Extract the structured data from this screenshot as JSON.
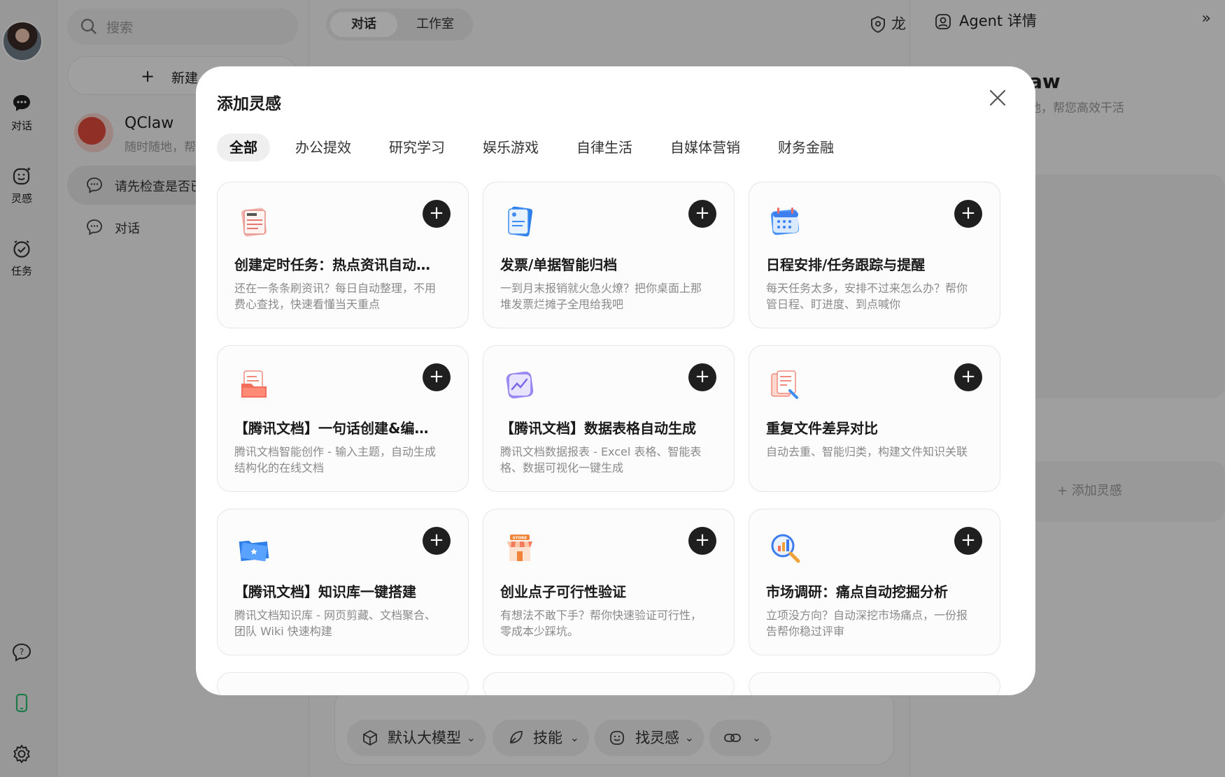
{
  "rail": {
    "items": [
      {
        "label": "对话",
        "icon": "chat-bubble-icon"
      },
      {
        "label": "灵感",
        "icon": "smile-sparkle-icon"
      },
      {
        "label": "任务",
        "icon": "clock-check-icon"
      }
    ],
    "bottom_icons": [
      "help-bubble-icon",
      "phone-icon",
      "settings-gear-icon"
    ]
  },
  "sidebar": {
    "search_placeholder": "搜索",
    "new_agent_label": "新建 A",
    "agent": {
      "name": "QClaw",
      "subtitle": "随时随地，帮"
    },
    "conversations": [
      {
        "label": "请先检查是否已"
      },
      {
        "label": "对话"
      }
    ]
  },
  "main": {
    "tabs": [
      {
        "label": "对话"
      },
      {
        "label": "工作室"
      }
    ],
    "header_right": "龙",
    "chips": [
      {
        "label": "默认大模型",
        "icon": "cube-icon"
      },
      {
        "label": "技能",
        "icon": "leaf-icon"
      },
      {
        "label": "找灵感",
        "icon": "smile-sparkle-icon"
      },
      {
        "label": "",
        "icon": "link-icon"
      }
    ]
  },
  "right_panel": {
    "header": "Agent 详情",
    "title_fragment": "aw",
    "subtitle_fragment": "地，帮您高效干活",
    "add_label": "添加灵感"
  },
  "modal": {
    "title": "添加灵感",
    "tabs": [
      "全部",
      "办公提效",
      "研究学习",
      "娱乐游戏",
      "自律生活",
      "自媒体营销",
      "财务金融"
    ],
    "active_tab": "全部",
    "cards": [
      {
        "title": "创建定时任务：热点资讯自动…",
        "desc": "还在一条条刷资讯？每日自动整理，不用费心查找，快速看懂当天重点",
        "icon": "news-paper-icon"
      },
      {
        "title": "发票/单据智能归档",
        "desc": "一到月末报销就火急火燎？把你桌面上那堆发票烂摊子全甩给我吧",
        "icon": "receipt-icon"
      },
      {
        "title": "日程安排/任务跟踪与提醒",
        "desc": "每天任务太多，安排不过来怎么办？帮你管日程、盯进度、到点喊你",
        "icon": "calendar-icon"
      },
      {
        "title": "【腾讯文档】一句话创建&编…",
        "desc": "腾讯文档智能创作 - 输入主题，自动生成结构化的在线文档",
        "icon": "document-folder-icon"
      },
      {
        "title": "【腾讯文档】数据表格自动生成",
        "desc": "腾讯文档数据报表 - Excel 表格、智能表格、数据可视化一键生成",
        "icon": "chart-card-icon"
      },
      {
        "title": "重复文件差异对比",
        "desc": "自动去重、智能归类，构建文件知识关联",
        "icon": "document-compare-icon"
      },
      {
        "title": "【腾讯文档】知识库一键搭建",
        "desc": "腾讯文档知识库 - 网页剪藏、文档聚合、团队 Wiki 快速构建",
        "icon": "blue-folder-icon"
      },
      {
        "title": "创业点子可行性验证",
        "desc": "有想法不敢下手？帮你快速验证可行性，零成本少踩坑。",
        "icon": "store-icon"
      },
      {
        "title": "市场调研：痛点自动挖掘分析",
        "desc": "立项没方向？自动深挖市场痛点，一份报告帮你稳过评审",
        "icon": "magnifier-chart-icon"
      }
    ],
    "add_glyph": "+",
    "colors": {
      "accent_dark": "#1f1f1f",
      "overlay": "rgba(0,0,0,0.36)"
    }
  }
}
